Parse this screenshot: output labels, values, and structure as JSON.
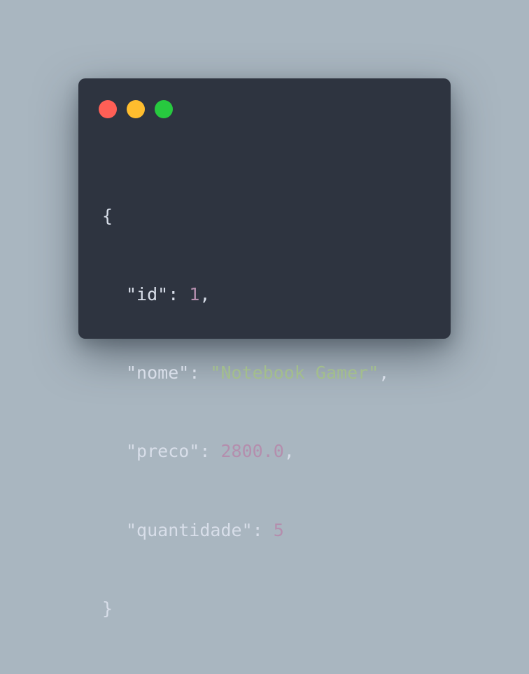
{
  "window": {
    "controls": [
      "close",
      "minimize",
      "maximize"
    ]
  },
  "code": {
    "open_brace": "{",
    "close_brace": "}",
    "lines": [
      {
        "key": "\"id\"",
        "sep": ": ",
        "value": "1",
        "value_type": "number",
        "trailing": ","
      },
      {
        "key": "\"nome\"",
        "sep": ": ",
        "value": "\"Notebook Gamer\"",
        "value_type": "string",
        "trailing": ","
      },
      {
        "key": "\"preco\"",
        "sep": ": ",
        "value": "2800.0",
        "value_type": "number",
        "trailing": ","
      },
      {
        "key": "\"quantidade\"",
        "sep": ": ",
        "value": "5",
        "value_type": "number",
        "trailing": ""
      }
    ]
  },
  "colors": {
    "background": "#a9b6c0",
    "window": "#2e3440",
    "text": "#d8dee9",
    "number": "#b48ead",
    "string": "#a3be8c",
    "close": "#ff5f56",
    "minimize": "#ffbd2e",
    "maximize": "#27c93f"
  }
}
